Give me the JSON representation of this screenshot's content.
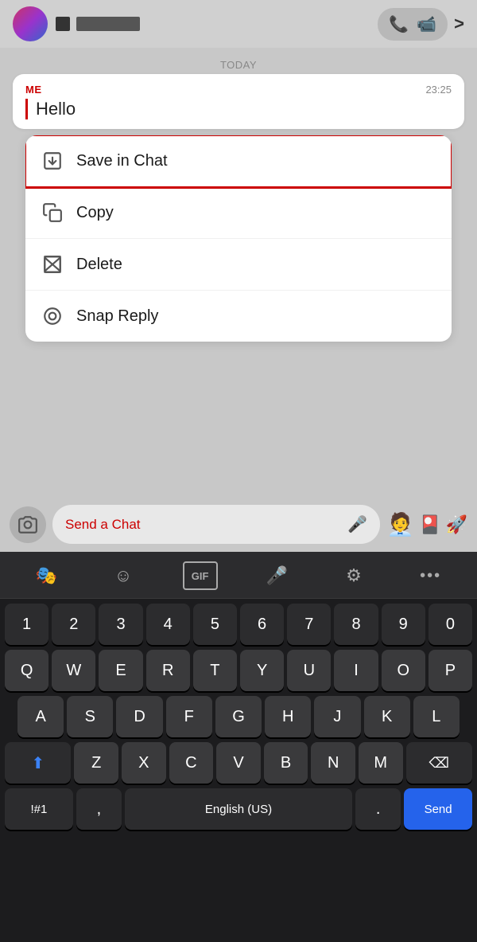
{
  "topBar": {
    "phoneIconLabel": "📞",
    "videoIconLabel": "📹",
    "chevronLabel": ">"
  },
  "chat": {
    "todayLabel": "TODAY",
    "message": {
      "sender": "ME",
      "time": "23:25",
      "text": "Hello"
    }
  },
  "contextMenu": {
    "items": [
      {
        "id": "save-in-chat",
        "label": "Save in Chat",
        "highlighted": true
      },
      {
        "id": "copy",
        "label": "Copy",
        "highlighted": false
      },
      {
        "id": "delete",
        "label": "Delete",
        "highlighted": false
      },
      {
        "id": "snap-reply",
        "label": "Snap Reply",
        "highlighted": false
      }
    ]
  },
  "inputBar": {
    "placeholder": "Send a Chat"
  },
  "keyboard": {
    "toolbarButtons": [
      "😀",
      "☺",
      "GIF",
      "🎤",
      "⚙",
      "•••"
    ],
    "rows": {
      "numbers": [
        "1",
        "2",
        "3",
        "4",
        "5",
        "6",
        "7",
        "8",
        "9",
        "0"
      ],
      "row1": [
        "Q",
        "W",
        "E",
        "R",
        "T",
        "Y",
        "U",
        "I",
        "O",
        "P"
      ],
      "row2": [
        "A",
        "S",
        "D",
        "F",
        "G",
        "H",
        "J",
        "K",
        "L"
      ],
      "row3": [
        "Z",
        "X",
        "C",
        "V",
        "B",
        "N",
        "M"
      ],
      "bottom": {
        "special": "!#1",
        "comma": ",",
        "space": "English (US)",
        "period": ".",
        "send": "Send"
      }
    }
  }
}
